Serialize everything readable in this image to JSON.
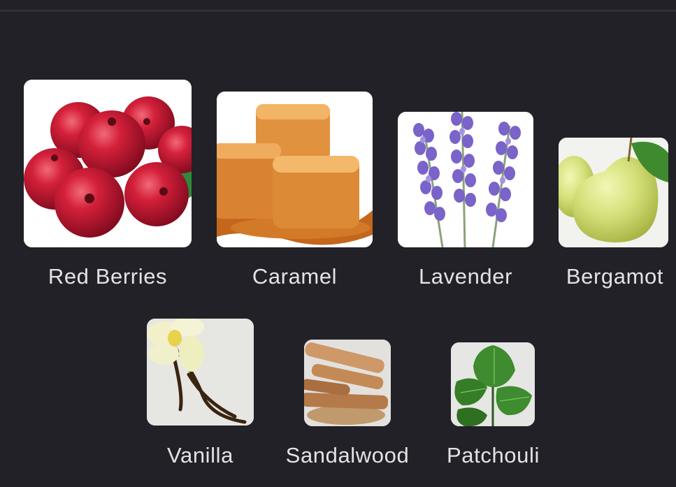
{
  "colors": {
    "background": "#222127",
    "label_text": "#e3e3e6"
  },
  "notes_row_1": [
    {
      "label": "Red Berries",
      "icon": "cranberries-image"
    },
    {
      "label": "Caramel",
      "icon": "caramel-image"
    },
    {
      "label": "Lavender",
      "icon": "lavender-image"
    },
    {
      "label": "Bergamot",
      "icon": "bergamot-image"
    }
  ],
  "notes_row_2": [
    {
      "label": "Vanilla",
      "icon": "vanilla-image"
    },
    {
      "label": "Sandalwood",
      "icon": "sandalwood-image"
    },
    {
      "label": "Patchouli",
      "icon": "patchouli-image"
    }
  ]
}
